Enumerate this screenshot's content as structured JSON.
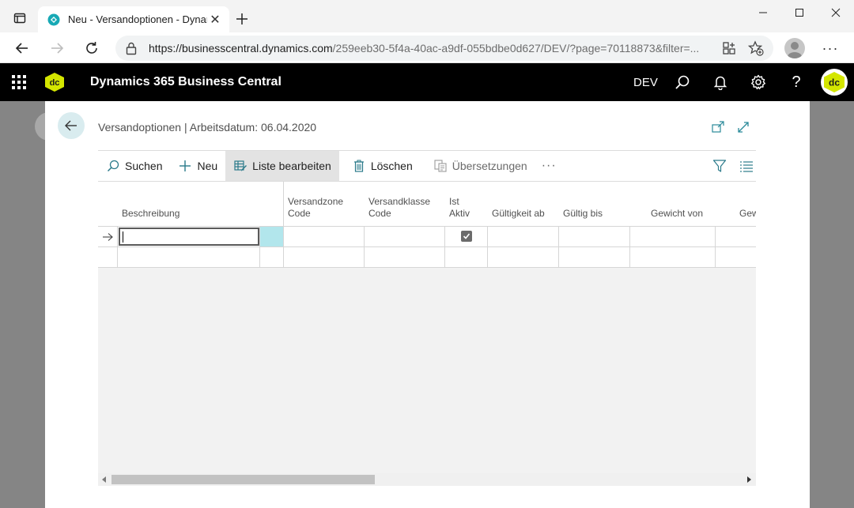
{
  "browser": {
    "tab_title": "Neu - Versandoptionen - Dynam",
    "url_host": "https://businesscentral.dynamics.com",
    "url_path": "/259eeb30-5f4a-40ac-a9df-055bdbe0d627/DEV/?page=70118873&filter=..."
  },
  "bc": {
    "app_title": "Dynamics 365 Business Central",
    "environment": "DEV",
    "logo_text": "dc"
  },
  "page": {
    "title": "Versandoptionen | Arbeitsdatum: 06.04.2020"
  },
  "actions": {
    "search": "Suchen",
    "new": "Neu",
    "edit_list": "Liste bearbeiten",
    "delete": "Löschen",
    "translations": "Übersetzungen",
    "more": "···"
  },
  "columns": [
    {
      "line1": "",
      "line2": "Beschreibung"
    },
    {
      "line1": "Versandzone",
      "line2": "Code"
    },
    {
      "line1": "Versandklasse",
      "line2": "Code"
    },
    {
      "line1": "Ist",
      "line2": "Aktiv"
    },
    {
      "line1": "",
      "line2": "Gültigkeit ab"
    },
    {
      "line1": "",
      "line2": "Gültig bis"
    },
    {
      "line1": "",
      "line2": "Gewicht von"
    },
    {
      "line1": "",
      "line2": "Gew"
    }
  ],
  "rows": [
    {
      "beschreibung": "",
      "ist_aktiv": true
    },
    {
      "beschreibung": "",
      "ist_aktiv": false
    }
  ],
  "colors": {
    "header_bg": "#000000",
    "accent_teal": "#b2e6ec",
    "back_button_bg": "#d9ecef",
    "logo_yellow": "#d4e600"
  }
}
